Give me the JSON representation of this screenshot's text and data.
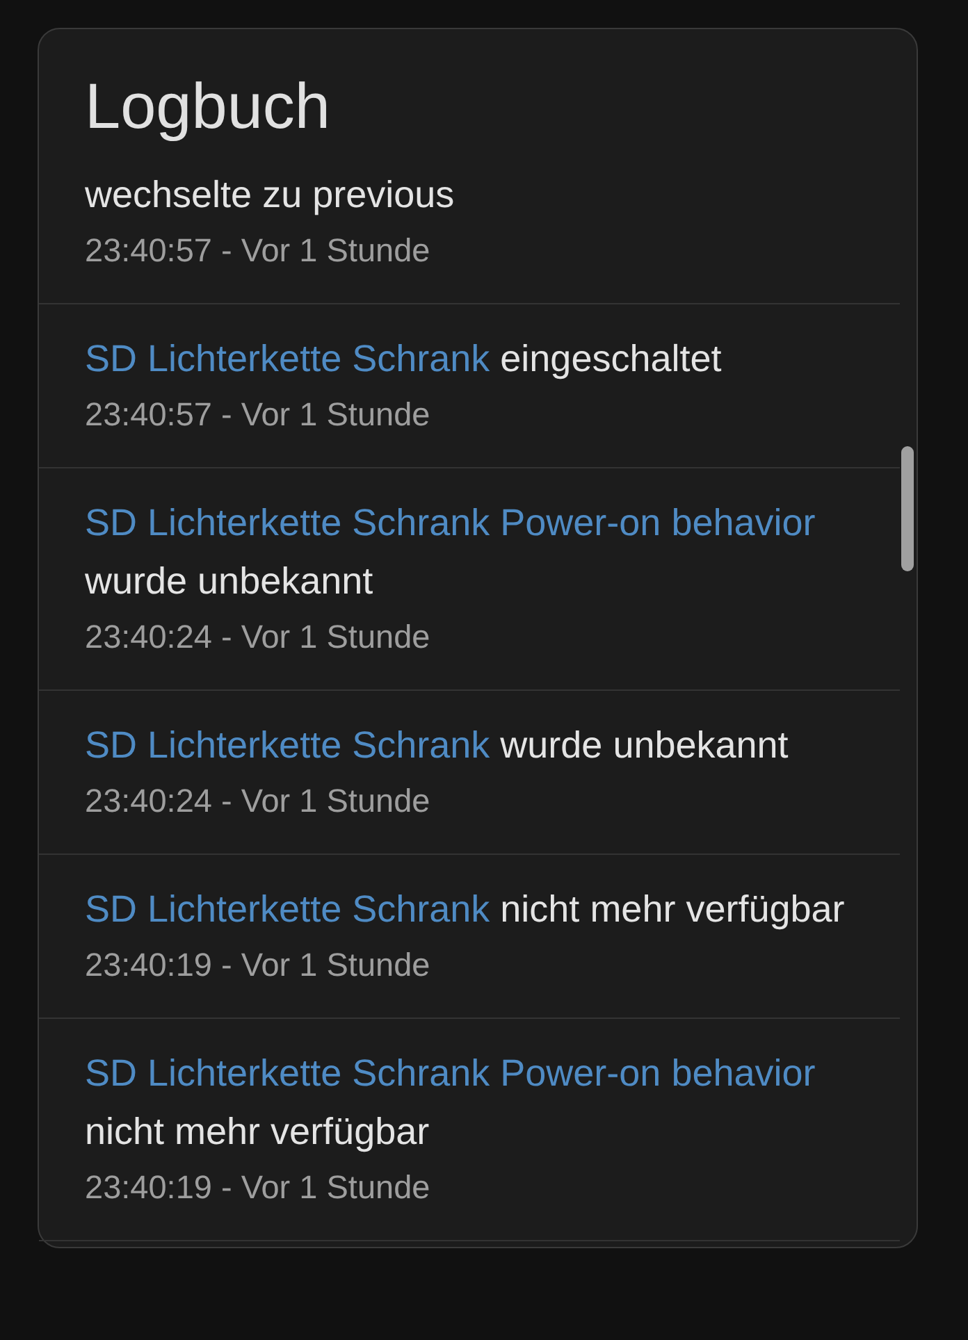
{
  "card": {
    "title": "Logbuch"
  },
  "entries": [
    {
      "message": "wechselte zu previous",
      "time": "23:40:57 - Vor 1 Stunde"
    },
    {
      "entity": "SD Lichterkette Schrank",
      "message": "eingeschaltet",
      "time": "23:40:57 - Vor 1 Stunde"
    },
    {
      "entity": "SD Lichterkette Schrank Power-on behavior",
      "message": "wurde unbekannt",
      "time": "23:40:24 - Vor 1 Stunde"
    },
    {
      "entity": "SD Lichterkette Schrank",
      "message": "wurde unbekannt",
      "time": "23:40:24 - Vor 1 Stunde"
    },
    {
      "entity": "SD Lichterkette Schrank",
      "message": "nicht mehr verfügbar",
      "time": "23:40:19 - Vor 1 Stunde"
    },
    {
      "entity": "SD Lichterkette Schrank Power-on behavior",
      "message": "nicht mehr verfügbar",
      "time": "23:40:19 - Vor 1 Stunde"
    }
  ]
}
